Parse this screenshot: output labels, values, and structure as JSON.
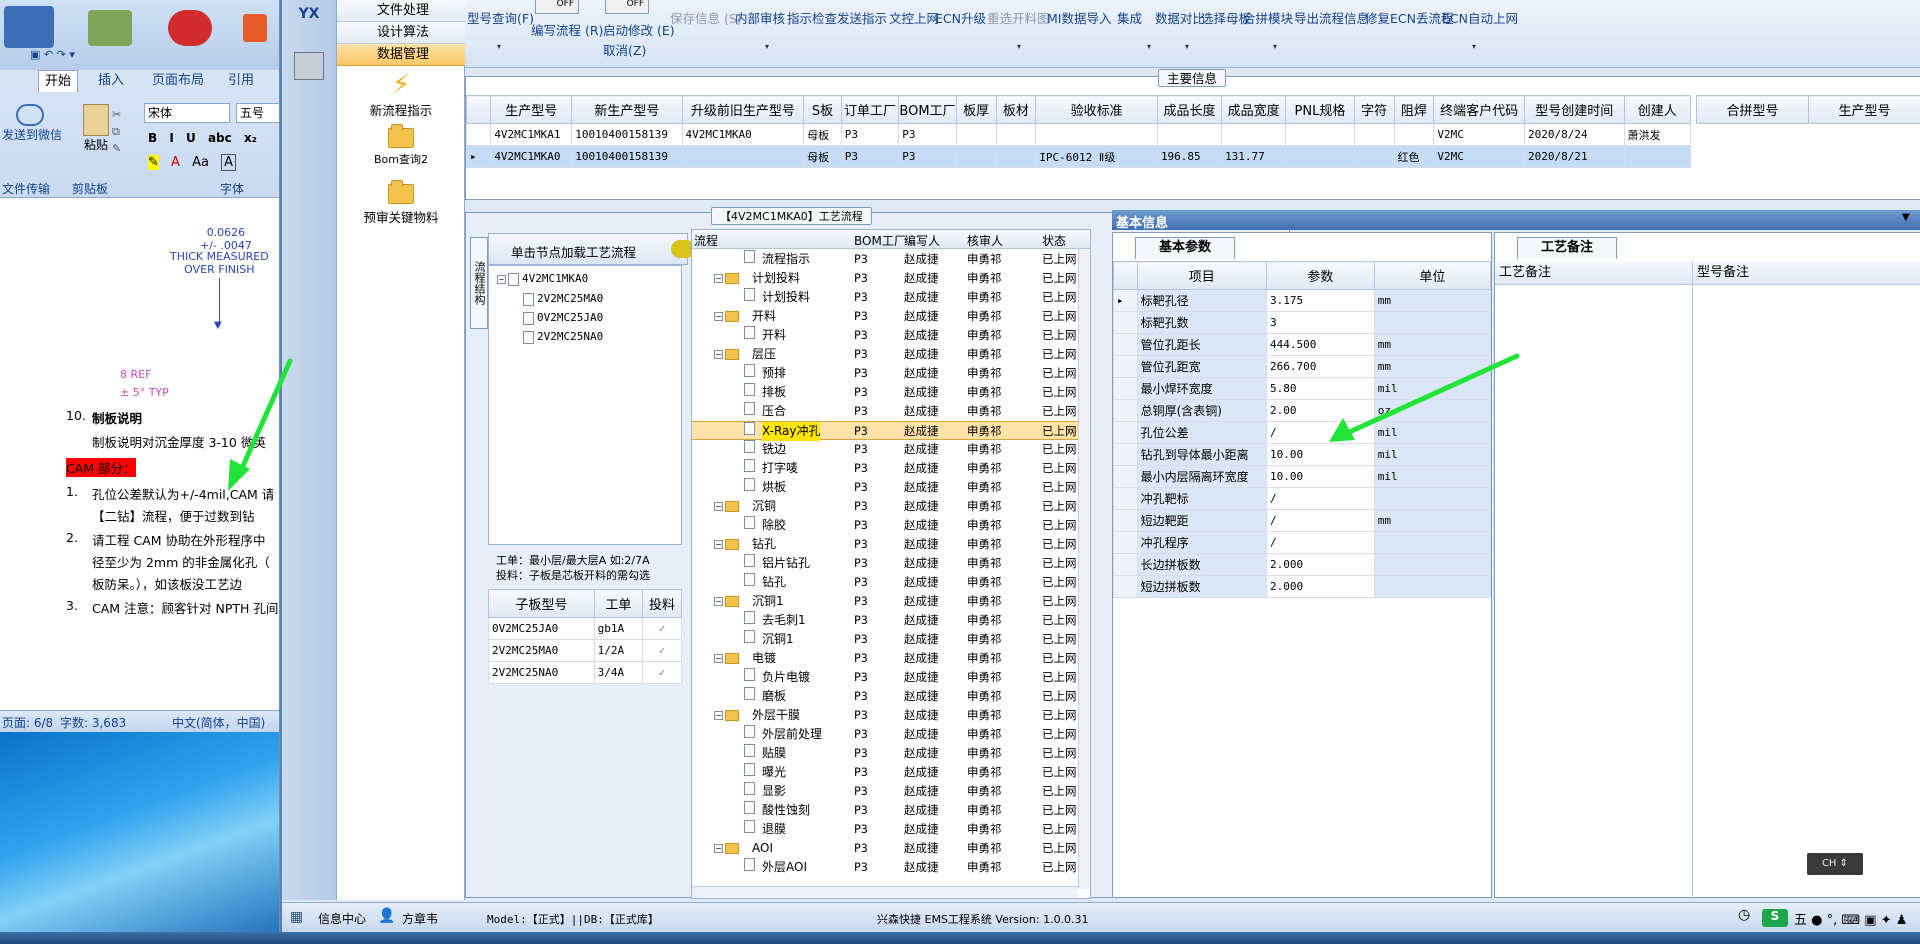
{
  "word": {
    "tabs": [
      "开始",
      "插入",
      "页面布局",
      "引用"
    ],
    "active_tab": "开始",
    "groups": {
      "wechat": "发送到微信",
      "file_transfer": "文件传输",
      "paste": "粘贴",
      "clipboard": "剪贴板",
      "font": "字体"
    },
    "font_name": "宋体",
    "font_size": "五号",
    "font_buttons": [
      "B",
      "I",
      "U",
      "abc",
      "x₂",
      "Aa",
      "A"
    ],
    "drawing": {
      "value1": "0.0626",
      "value2": "+/- .0047",
      "label1": "THICK MEASURED",
      "label2": "OVER FINISH",
      "ref": "8 REF",
      "typ": "± 5° TYP"
    },
    "doc_lines": [
      {
        "num": "10.",
        "text": "制板说明"
      },
      {
        "num": "",
        "text": "制板说明对沉金厚度 3-10 微英"
      },
      {
        "num": "",
        "text": "CAM 部分："
      },
      {
        "num": "1.",
        "text": "孔位公差默认为+/-4mil,CAM 请"
      },
      {
        "num": "",
        "text": "【二钻】流程，便于过数到钻"
      },
      {
        "num": "2.",
        "text": "请工程 CAM 协助在外形程序中"
      },
      {
        "num": "",
        "text": "径至少为 2mm 的非金属化孔（"
      },
      {
        "num": "",
        "text": "板防呆。），如该板没工艺边"
      },
      {
        "num": "3.",
        "text": "CAM 注意：顾客针对 NPTH 孔间"
      }
    ],
    "status": {
      "page": "页面: 6/8",
      "words": "字数: 3,683",
      "lang": "中文(简体，中国)"
    }
  },
  "app": {
    "logo": "YX",
    "nav_rows": [
      "文件处理",
      "设计算法",
      "数据管理"
    ],
    "nav_selected": "数据管理",
    "nav_items": [
      "新流程指示",
      "Bom查询2",
      "预审关键物料"
    ],
    "toolbar": {
      "toggle_off": "OFF",
      "buttons": [
        {
          "label": "型号查询(F)",
          "enabled": true
        },
        {
          "label": "编写流程 (R)",
          "enabled": true
        },
        {
          "label": "启动修改 (E)",
          "enabled": true
        },
        {
          "label": "取消(Z)",
          "enabled": true
        },
        {
          "label": "保存信息 (S)",
          "enabled": false
        },
        {
          "label": "内部审核",
          "enabled": true
        },
        {
          "label": "指示检查",
          "enabled": true
        },
        {
          "label": "发送指示",
          "enabled": true
        },
        {
          "label": "文控上网",
          "enabled": true
        },
        {
          "label": "ECN升级",
          "enabled": true
        },
        {
          "label": "重选开料图",
          "enabled": false
        },
        {
          "label": "MI数据导入",
          "enabled": true
        },
        {
          "label": "集成",
          "enabled": true
        },
        {
          "label": "数据对比",
          "enabled": true
        },
        {
          "label": "选择母板",
          "enabled": true
        },
        {
          "label": "合拼模块",
          "enabled": true
        },
        {
          "label": "导出流程信息",
          "enabled": true
        },
        {
          "label": "修复ECN丢流程",
          "enabled": true
        },
        {
          "label": "ECN自动上网",
          "enabled": true
        }
      ]
    },
    "main_info": {
      "title": "主要信息",
      "columns": [
        "生产型号",
        "新生产型号",
        "升级前旧生产型号",
        "S板",
        "订单工厂",
        "BOM工厂",
        "板厚",
        "板材",
        "验收标准",
        "成品长度",
        "成品宽度",
        "PNL规格",
        "字符",
        "阻焊",
        "终端客户代码",
        "型号创建时间",
        "创建人"
      ],
      "rows": [
        [
          "4V2MC1MKA1",
          "10010400158139",
          "4V2MC1MKA0",
          "母板",
          "P3",
          "P3",
          "",
          "",
          "",
          "",
          "",
          "",
          "",
          "",
          "V2MC",
          "2020/8/24",
          "萧洪发"
        ],
        [
          "4V2MC1MKA0",
          "10010400158139",
          "",
          "母板",
          "P3",
          "P3",
          "",
          "",
          "IPC-6012 Ⅱ级",
          "196.85",
          "131.77",
          "",
          "",
          "红色",
          "V2MC",
          "2020/8/21",
          ""
        ]
      ],
      "selected_row": 1,
      "side_columns": [
        "合拼型号",
        "生产型号"
      ]
    },
    "process": {
      "title": "【4V2MC1MKA0】工艺流程",
      "side_tab": "流程结构",
      "tree_header": "单击节点加载工艺流程",
      "tree_root": "4V2MC1MKA0",
      "tree_children": [
        "2V2MC25MA0",
        "0V2MC25JA0",
        "2V2MC25NA0"
      ],
      "note_line1": "工单：最小层/最大层A 如:2/7A",
      "note_line2": "投料：子板是芯板开料的需勾选",
      "sub_columns": [
        "子板型号",
        "工单",
        "投料"
      ],
      "sub_rows": [
        [
          "0V2MC25JA0",
          "gb1A",
          "✓"
        ],
        [
          "2V2MC25MA0",
          "1/2A",
          "✓"
        ],
        [
          "2V2MC25NA0",
          "3/4A",
          "✓"
        ]
      ],
      "flow_columns": [
        "流程",
        "BOM工厂",
        "编写人",
        "核审人",
        "状态"
      ],
      "flow_rows": [
        {
          "type": "item",
          "name": "流程指示",
          "bom": "P3",
          "writer": "赵成捷",
          "reviewer": "申勇祁",
          "status": "已上网"
        },
        {
          "type": "group",
          "name": "计划投料",
          "bom": "P3",
          "writer": "赵成捷",
          "reviewer": "申勇祁",
          "status": "已上网"
        },
        {
          "type": "item",
          "name": "计划投料",
          "bom": "P3",
          "writer": "赵成捷",
          "reviewer": "申勇祁",
          "status": "已上网"
        },
        {
          "type": "group",
          "name": "开料",
          "bom": "P3",
          "writer": "赵成捷",
          "reviewer": "申勇祁",
          "status": "已上网"
        },
        {
          "type": "item",
          "name": "开料",
          "bom": "P3",
          "writer": "赵成捷",
          "reviewer": "申勇祁",
          "status": "已上网"
        },
        {
          "type": "group",
          "name": "层压",
          "bom": "P3",
          "writer": "赵成捷",
          "reviewer": "申勇祁",
          "status": "已上网"
        },
        {
          "type": "item",
          "name": "预排",
          "bom": "P3",
          "writer": "赵成捷",
          "reviewer": "申勇祁",
          "status": "已上网"
        },
        {
          "type": "item",
          "name": "排板",
          "bom": "P3",
          "writer": "赵成捷",
          "reviewer": "申勇祁",
          "status": "已上网"
        },
        {
          "type": "item",
          "name": "压合",
          "bom": "P3",
          "writer": "赵成捷",
          "reviewer": "申勇祁",
          "status": "已上网"
        },
        {
          "type": "item",
          "name": "X-Ray冲孔",
          "bom": "P3",
          "writer": "赵成捷",
          "reviewer": "申勇祁",
          "status": "已上网",
          "selected": true
        },
        {
          "type": "item",
          "name": "铣边",
          "bom": "P3",
          "writer": "赵成捷",
          "reviewer": "申勇祁",
          "status": "已上网"
        },
        {
          "type": "item",
          "name": "打字唛",
          "bom": "P3",
          "writer": "赵成捷",
          "reviewer": "申勇祁",
          "status": "已上网"
        },
        {
          "type": "item",
          "name": "烘板",
          "bom": "P3",
          "writer": "赵成捷",
          "reviewer": "申勇祁",
          "status": "已上网"
        },
        {
          "type": "group",
          "name": "沉铜",
          "bom": "P3",
          "writer": "赵成捷",
          "reviewer": "申勇祁",
          "status": "已上网"
        },
        {
          "type": "item",
          "name": "除胶",
          "bom": "P3",
          "writer": "赵成捷",
          "reviewer": "申勇祁",
          "status": "已上网"
        },
        {
          "type": "group",
          "name": "钻孔",
          "bom": "P3",
          "writer": "赵成捷",
          "reviewer": "申勇祁",
          "status": "已上网"
        },
        {
          "type": "item",
          "name": "铝片钻孔",
          "bom": "P3",
          "writer": "赵成捷",
          "reviewer": "申勇祁",
          "status": "已上网"
        },
        {
          "type": "item",
          "name": "钻孔",
          "bom": "P3",
          "writer": "赵成捷",
          "reviewer": "申勇祁",
          "status": "已上网"
        },
        {
          "type": "group",
          "name": "沉铜1",
          "bom": "P3",
          "writer": "赵成捷",
          "reviewer": "申勇祁",
          "status": "已上网"
        },
        {
          "type": "item",
          "name": "去毛刺1",
          "bom": "P3",
          "writer": "赵成捷",
          "reviewer": "申勇祁",
          "status": "已上网"
        },
        {
          "type": "item",
          "name": "沉铜1",
          "bom": "P3",
          "writer": "赵成捷",
          "reviewer": "申勇祁",
          "status": "已上网"
        },
        {
          "type": "group",
          "name": "电镀",
          "bom": "P3",
          "writer": "赵成捷",
          "reviewer": "申勇祁",
          "status": "已上网"
        },
        {
          "type": "item",
          "name": "负片电镀",
          "bom": "P3",
          "writer": "赵成捷",
          "reviewer": "申勇祁",
          "status": "已上网"
        },
        {
          "type": "item",
          "name": "磨板",
          "bom": "P3",
          "writer": "赵成捷",
          "reviewer": "申勇祁",
          "status": "已上网"
        },
        {
          "type": "group",
          "name": "外层干膜",
          "bom": "P3",
          "writer": "赵成捷",
          "reviewer": "申勇祁",
          "status": "已上网"
        },
        {
          "type": "item",
          "name": "外层前处理",
          "bom": "P3",
          "writer": "赵成捷",
          "reviewer": "申勇祁",
          "status": "已上网"
        },
        {
          "type": "item",
          "name": "贴膜",
          "bom": "P3",
          "writer": "赵成捷",
          "reviewer": "申勇祁",
          "status": "已上网"
        },
        {
          "type": "item",
          "name": "曝光",
          "bom": "P3",
          "writer": "赵成捷",
          "reviewer": "申勇祁",
          "status": "已上网"
        },
        {
          "type": "item",
          "name": "显影",
          "bom": "P3",
          "writer": "赵成捷",
          "reviewer": "申勇祁",
          "status": "已上网"
        },
        {
          "type": "item",
          "name": "酸性蚀刻",
          "bom": "P3",
          "writer": "赵成捷",
          "reviewer": "申勇祁",
          "status": "已上网"
        },
        {
          "type": "item",
          "name": "退膜",
          "bom": "P3",
          "writer": "赵成捷",
          "reviewer": "申勇祁",
          "status": "已上网"
        },
        {
          "type": "group",
          "name": "AOI",
          "bom": "P3",
          "writer": "赵成捷",
          "reviewer": "申勇祁",
          "status": "已上网"
        },
        {
          "type": "item",
          "name": "外层AOI",
          "bom": "P3",
          "writer": "赵成捷",
          "reviewer": "申勇祁",
          "status": "已上网"
        }
      ]
    },
    "basic_info": {
      "title": "基本信息",
      "tab": "基本参数",
      "columns": [
        "项目",
        "参数",
        "单位"
      ],
      "rows": [
        [
          "标靶孔径",
          "3.175",
          "mm"
        ],
        [
          "标靶孔数",
          "3",
          ""
        ],
        [
          "管位孔距长",
          "444.500",
          "mm"
        ],
        [
          "管位孔距宽",
          "266.700",
          "mm"
        ],
        [
          "最小焊环宽度",
          "5.80",
          "mil"
        ],
        [
          "总铜厚(含表铜)",
          "2.00",
          "oz"
        ],
        [
          "孔位公差",
          "/",
          "mil"
        ],
        [
          "钻孔到导体最小距离",
          "10.00",
          "mil"
        ],
        [
          "最小内层隔离环宽度",
          "10.00",
          "mil"
        ],
        [
          "冲孔靶标",
          "/",
          ""
        ],
        [
          "短边靶距",
          "/",
          "mm"
        ],
        [
          "冲孔程序",
          "/",
          ""
        ],
        [
          "长边拼板数",
          "2.000",
          ""
        ],
        [
          "短边拼板数",
          "2.000",
          ""
        ]
      ]
    },
    "remarks": {
      "tab": "工艺备注",
      "col1": "工艺备注",
      "col2": "型号备注"
    },
    "statusbar": {
      "info_center": "信息中心",
      "user": "方章韦",
      "model": "Model:【正式】||DB:【正式库】",
      "system": "兴森快捷 EMS工程系统 Version: 1.0.0.31"
    },
    "ime": {
      "lang": "CH",
      "tray": "五"
    }
  },
  "colors": {
    "accent": "#15428b",
    "selection": "#f9c765",
    "row_select": "#c5dcf5",
    "arrow": "#22e33a",
    "highlight_red": "#ff0000"
  }
}
